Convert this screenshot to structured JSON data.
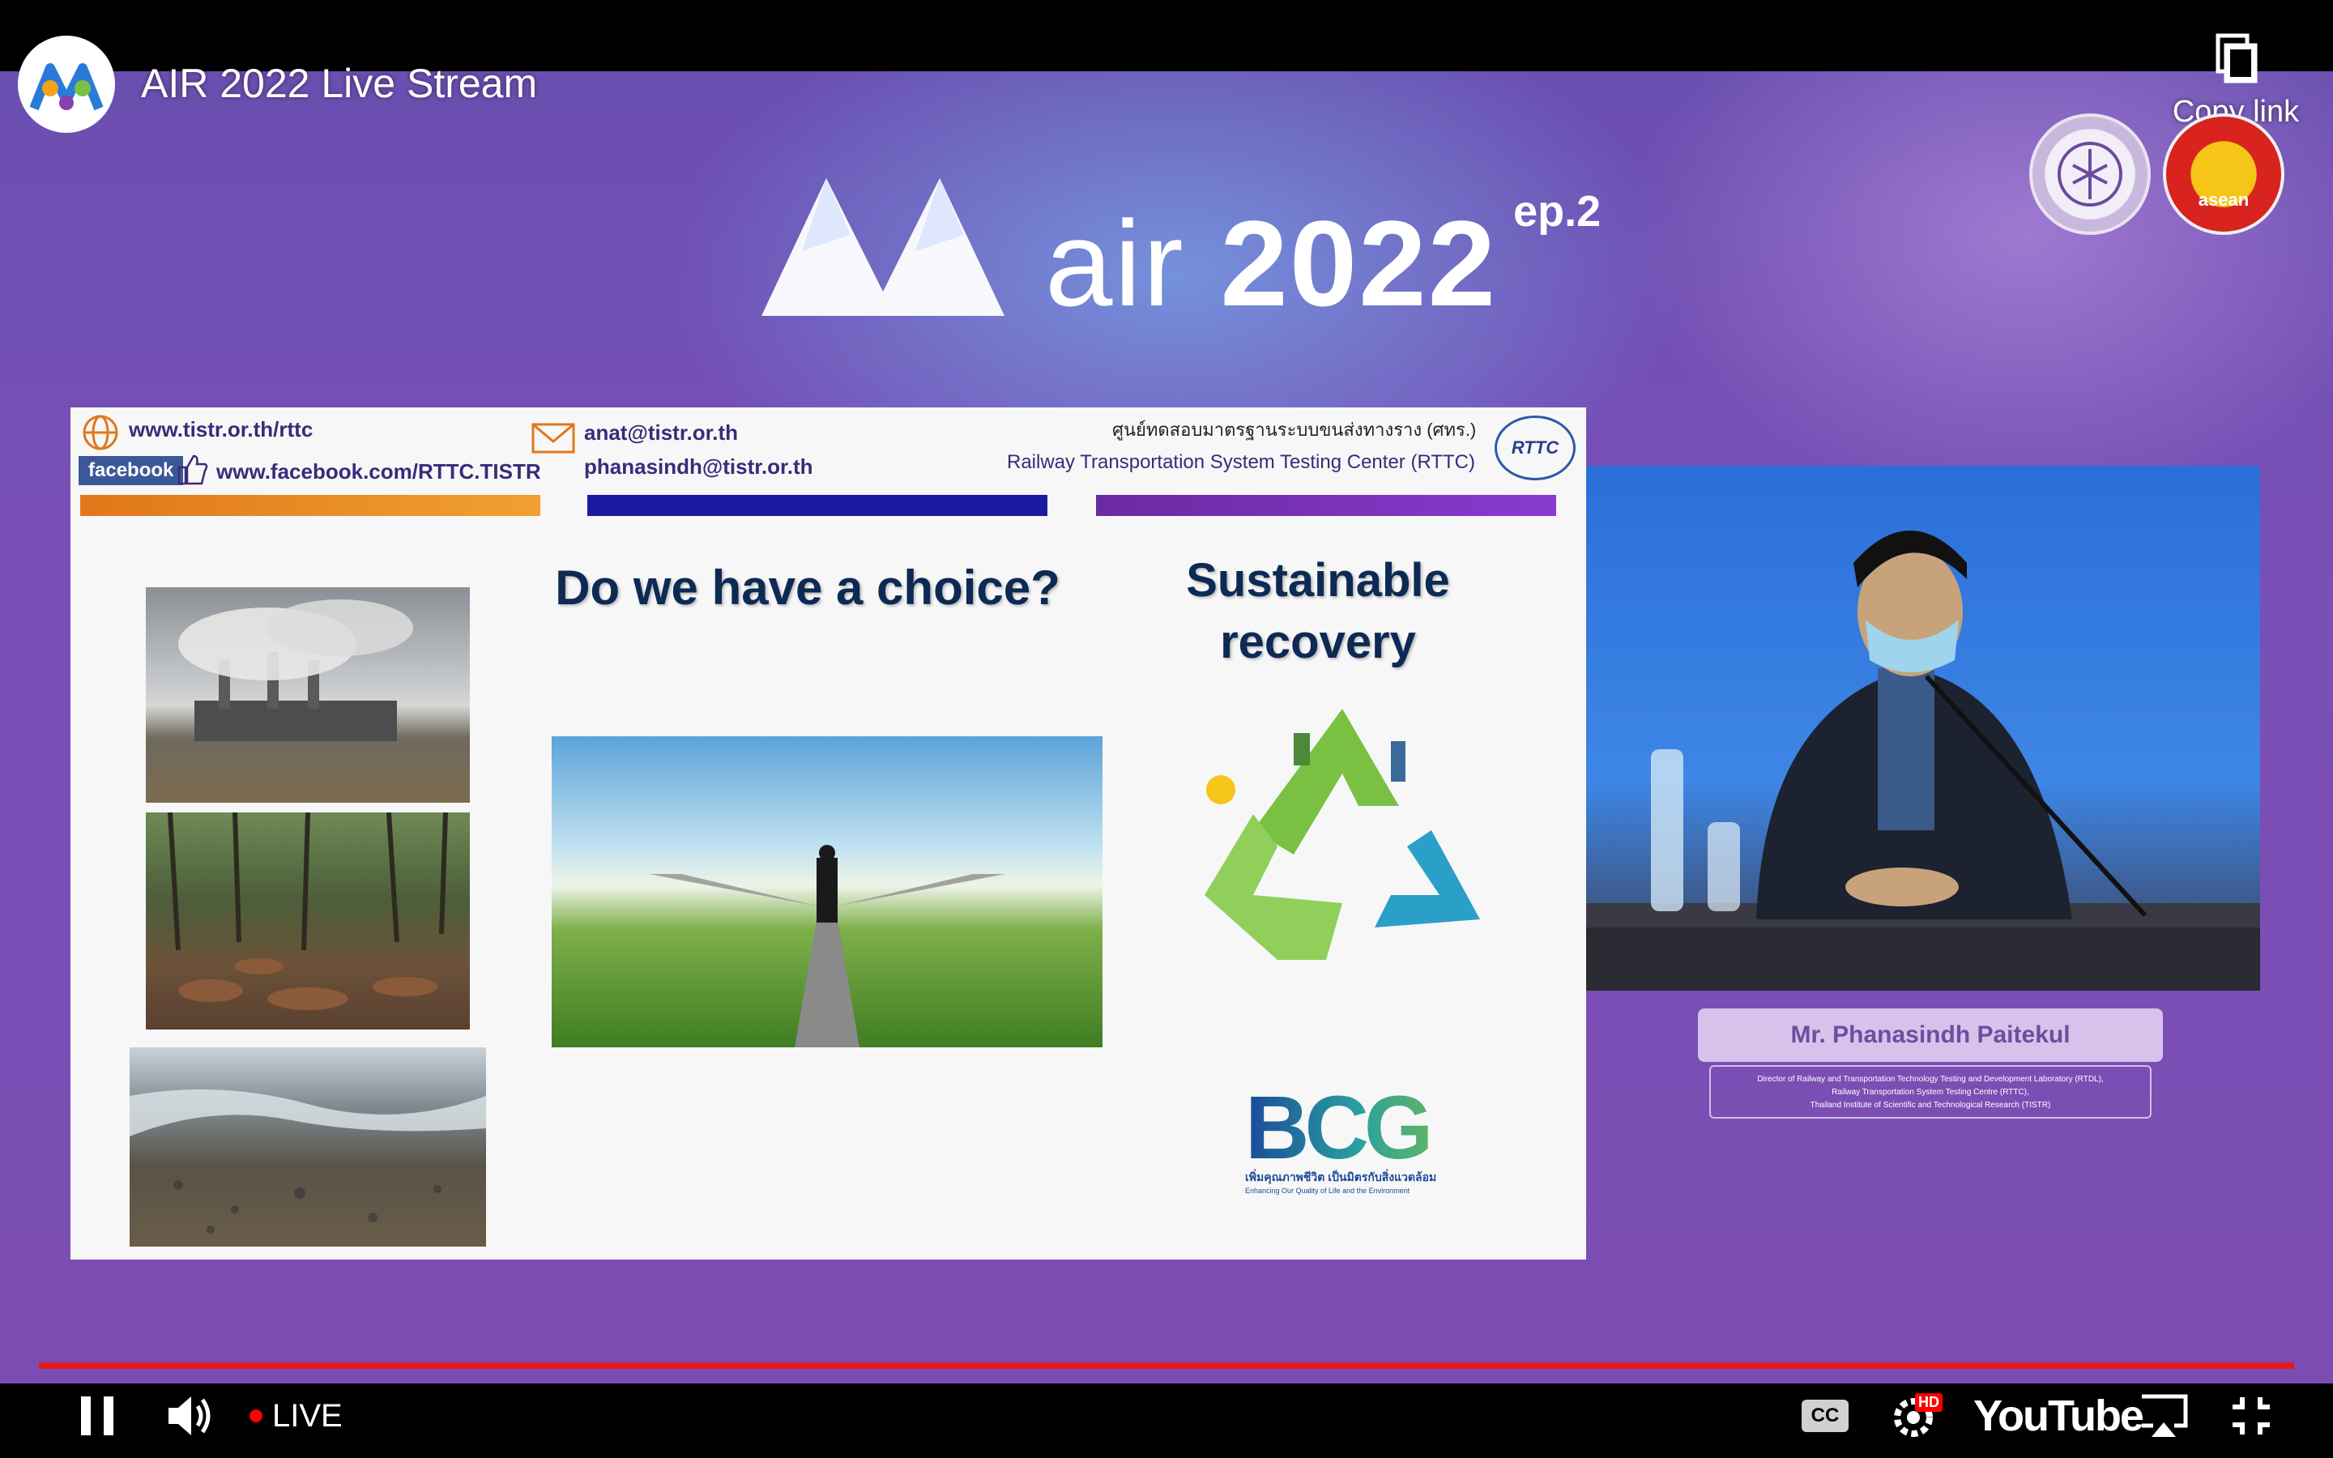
{
  "header": {
    "channel_avatar_icon": "air-logo-icon",
    "video_title": "AIR 2022 Live Stream",
    "copy_link_label": "Copy link"
  },
  "event_banner": {
    "name": "air",
    "year": "2022",
    "episode": "ep.2"
  },
  "seals": {
    "asean_text": "asean"
  },
  "slide": {
    "website": "www.tistr.or.th/rttc",
    "facebook_badge": "facebook",
    "facebook_url": "www.facebook.com/RTTC.TISTR",
    "email_1": "anat@tistr.or.th",
    "email_2": "phanasindh@tistr.or.th",
    "center_name_th": "ศูนย์ทดสอบมาตรฐานระบบขนส่งทางราง (ศทร.)",
    "center_name_en": "Railway Transportation System Testing Center (RTTC)",
    "rttc_logo": "RTTC",
    "heading_choice": "Do we have a choice?",
    "heading_sustainable_1": "Sustainable",
    "heading_sustainable_2": "recovery",
    "bcg_logo": "BCG",
    "bcg_tagline_th": "เพิ่มคุณภาพชีวิต เป็นมิตรกับสิ่งแวดล้อม",
    "bcg_tagline_en": "Enhancing Our Quality of Life and the Environment"
  },
  "speaker": {
    "name": "Mr. Phanasindh Paitekul",
    "title_line_1": "Director of Railway and Transportation Technology Testing and Development Laboratory (RTDL),",
    "title_line_2": "Railway Transportation System Testing Centre (RTTC),",
    "title_line_3": "Thailand Institute of Scientific and Technological Research (TISTR)"
  },
  "controls": {
    "live_label": "LIVE",
    "youtube_label": "YouTube",
    "hd_badge": "HD",
    "cc_label": "CC"
  },
  "colors": {
    "progress": "#e21b1b",
    "live_dot": "#ff0000",
    "slide_heading": "#0d2a55"
  }
}
